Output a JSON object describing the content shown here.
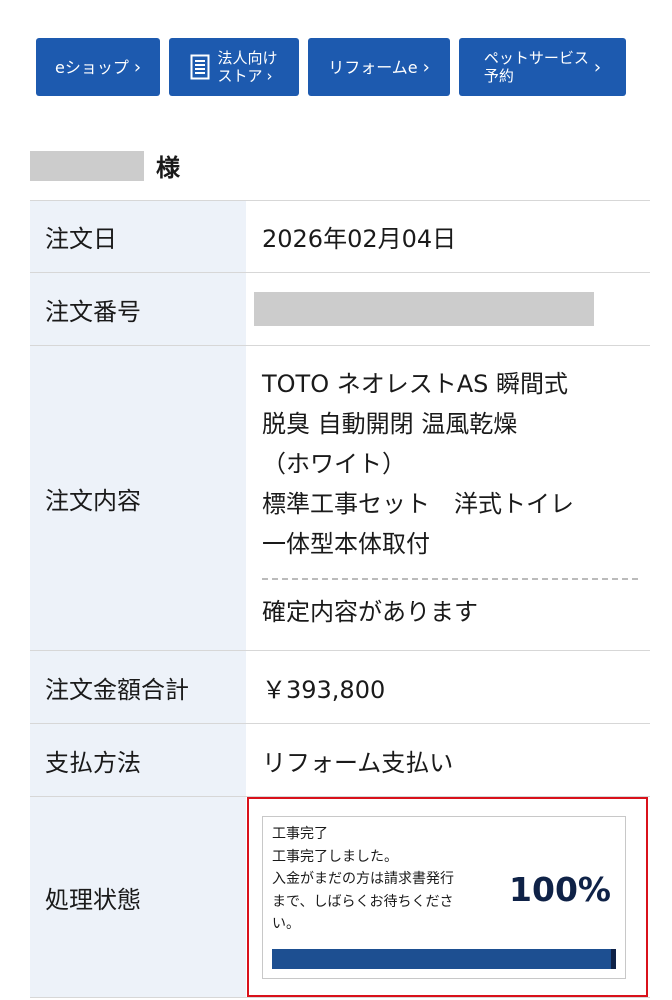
{
  "nav": {
    "eshop": "eショップ",
    "corporate_line1": "法人向け",
    "corporate_line2": "ストア",
    "reform": "リフォームe",
    "pet_line1": "ペットサービス",
    "pet_line2": "予約",
    "chevron": "›"
  },
  "customer": {
    "honorific": "様"
  },
  "order": {
    "date_label": "注文日",
    "date_value": "2026年02月04日",
    "number_label": "注文番号",
    "content_label": "注文内容",
    "content_lines": [
      "TOTO ネオレストAS 瞬間式",
      "脱臭 自動開閉 温風乾燥",
      "（ホワイト）",
      "標準工事セット　洋式トイレ",
      "一体型本体取付"
    ],
    "content_note": "確定内容があります",
    "amount_label": "注文金額合計",
    "amount_value": "￥393,800",
    "payment_label": "支払方法",
    "payment_value": "リフォーム支払い",
    "status_label": "処理状態",
    "status_lines": [
      "工事完了",
      "工事完了しました。",
      "入金がまだの方は請求書発行",
      "まで、しばらくお待ちくださ",
      "い。"
    ],
    "status_percent": "100%",
    "progress_fraction": 1.0
  },
  "colors": {
    "nav_blue": "#1d5aaf",
    "label_bg": "#edf2f9",
    "highlight_red": "#d9111b",
    "bar_blue": "#1d4f91"
  }
}
